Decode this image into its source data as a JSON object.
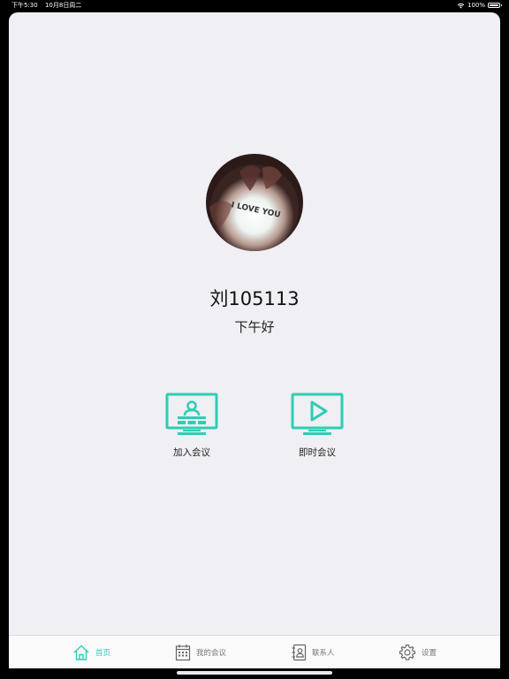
{
  "status_bar": {
    "time": "下午5:30",
    "date": "10月8日周二",
    "battery_text": "100%",
    "wifi_icon": "wifi-icon",
    "battery_icon": "battery-icon",
    "battery_level": 1.0
  },
  "profile": {
    "avatar_text": "I LOVE YOU",
    "name": "刘105113",
    "greeting": "下午好"
  },
  "actions": [
    {
      "label": "加入会议",
      "icon": "join-meeting-icon"
    },
    {
      "label": "即时会议",
      "icon": "instant-meeting-icon"
    }
  ],
  "tabbar": {
    "items": [
      {
        "label": "首页",
        "icon": "home-icon",
        "active": true
      },
      {
        "label": "我的会议",
        "icon": "calendar-icon",
        "active": false
      },
      {
        "label": "联系人",
        "icon": "contacts-icon",
        "active": false
      },
      {
        "label": "设置",
        "icon": "settings-icon",
        "active": false
      }
    ]
  },
  "colors": {
    "accent": "#2ecdb3",
    "background": "#efeff4",
    "inactive": "#777777"
  }
}
